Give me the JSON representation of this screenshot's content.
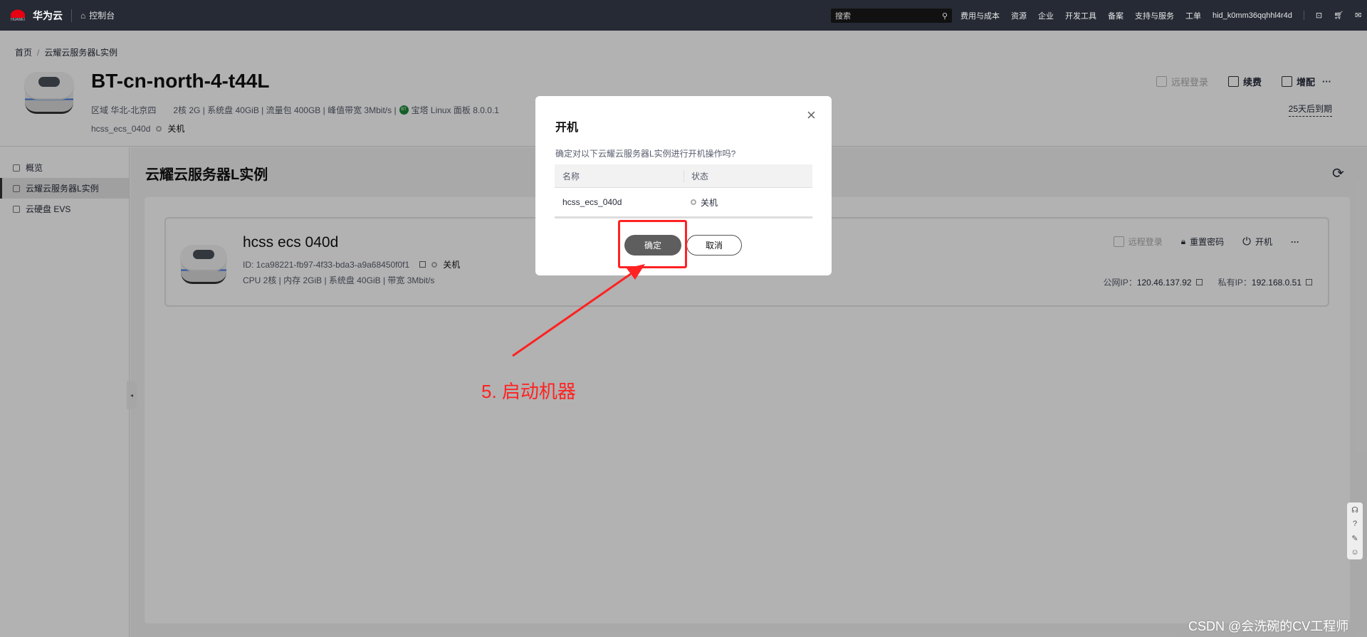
{
  "topbar": {
    "brand": "华为云",
    "logo_sub": "HUAWEI",
    "console": "控制台",
    "search_placeholder": "搜索",
    "nav": [
      "费用与成本",
      "资源",
      "企业",
      "开发工具",
      "备案",
      "支持与服务",
      "工单"
    ],
    "user": "hid_k0mm36qqhhl4r4d"
  },
  "header": {
    "breadcrumb": [
      "首页",
      "云耀云服务器L实例"
    ],
    "title": "BT-cn-north-4-t44L",
    "region": "区域 华北-北京四",
    "specs": "2核  2G | 系统盘 40GiB | 流量包 400GB | 峰值带宽 3Mbit/s |",
    "bt_badge": "BT",
    "image": "宝塔 Linux 面板 8.0.0.1",
    "instance": "hcss_ecs_040d",
    "status": "关机",
    "actions": [
      "远程登录",
      "续费",
      "增配"
    ],
    "more": "···",
    "expire": "25天后到期"
  },
  "sidebar": {
    "items": [
      "概览",
      "云耀云服务器L实例",
      "云硬盘 EVS"
    ],
    "collapse": "◂"
  },
  "main": {
    "title": "云耀云服务器L实例",
    "refresh": "⟳",
    "card": {
      "name": "hcss  ecs  040d",
      "id": "ID: 1ca98221-fb97-4f33-bda3-a9a68450f0f1",
      "status": "关机",
      "spec": "CPU 2核 | 内存 2GiB | 系统盘 40GiB | 带宽 3Mbit/s",
      "actions": [
        "远程登录",
        "重置密码",
        "开机"
      ],
      "more": "···",
      "public_ip_label": "公网IP：",
      "public_ip": "120.46.137.92",
      "private_ip_label": "私有IP：",
      "private_ip": "192.168.0.51"
    }
  },
  "dialog": {
    "title": "开机",
    "close": "×",
    "message": "确定对以下云耀云服务器L实例进行开机操作吗?",
    "columns": [
      "名称",
      "状态"
    ],
    "rows": [
      {
        "name": "hcss_ecs_040d",
        "status": "关机"
      }
    ],
    "ok": "确定",
    "cancel": "取消"
  },
  "annotation": {
    "label": "5. 启动机器",
    "color": "#ff2222"
  },
  "float_tools": [
    "☊",
    "?",
    "✎",
    "☺"
  ],
  "watermark": "CSDN @会洗碗的CV工程师"
}
